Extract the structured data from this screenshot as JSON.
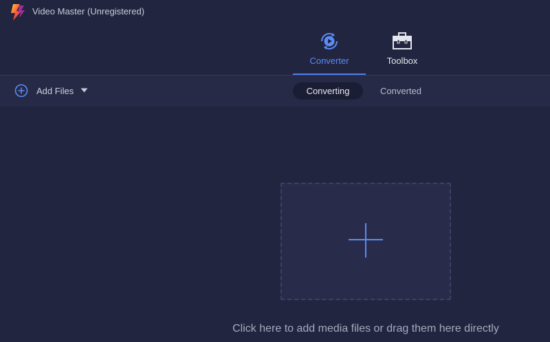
{
  "app": {
    "title": "Video Master (Unregistered)"
  },
  "nav": {
    "tabs": [
      {
        "label": "Converter",
        "icon": "converter-icon",
        "active": true
      },
      {
        "label": "Toolbox",
        "icon": "toolbox-icon",
        "active": false
      }
    ]
  },
  "toolbar": {
    "add_files_label": "Add Files",
    "segments": [
      {
        "label": "Converting",
        "active": true
      },
      {
        "label": "Converted",
        "active": false
      }
    ]
  },
  "dropzone": {
    "hint": "Click here to add media files or drag them here directly"
  },
  "colors": {
    "background": "#21253f",
    "toolbar": "#262a46",
    "accent": "#4f7df0",
    "dropzone": "#282c4a"
  }
}
